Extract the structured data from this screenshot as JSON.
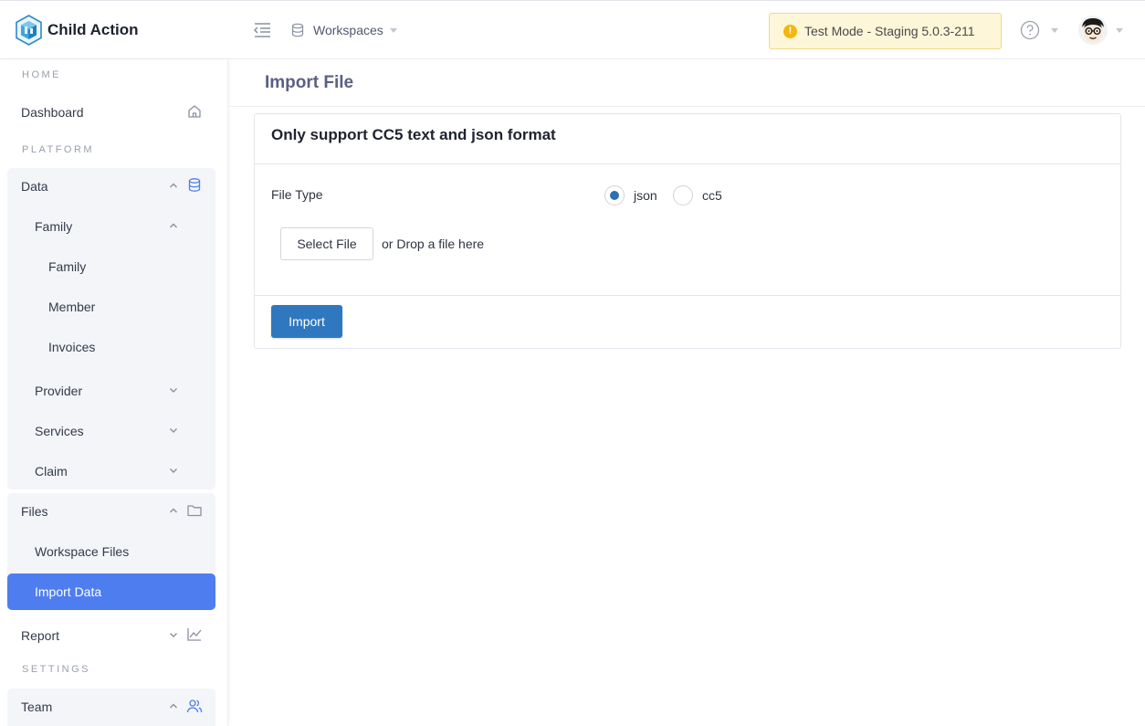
{
  "brand": {
    "name": "Child Action"
  },
  "topbar": {
    "workspaces_label": "Workspaces",
    "test_mode": "Test Mode - Staging 5.0.3-211",
    "icons": {
      "menu": "menu-fold-icon",
      "workspace": "database-icon",
      "warning": "warning-icon",
      "help": "help-circle-icon",
      "avatar": "avatar-icon"
    }
  },
  "sidebar": {
    "sections": {
      "home": "HOME",
      "platform": "PLATFORM",
      "settings": "SETTINGS"
    },
    "dashboard": "Dashboard",
    "data": {
      "label": "Data",
      "family": {
        "label": "Family",
        "items": [
          "Family",
          "Member",
          "Invoices"
        ]
      },
      "provider": "Provider",
      "services": "Services",
      "claim": "Claim"
    },
    "files": {
      "label": "Files",
      "workspace_files": "Workspace Files",
      "import_data": "Import Data"
    },
    "report": "Report",
    "team": "Team",
    "active_color": "#4e7df0"
  },
  "page": {
    "title": "Import File"
  },
  "card": {
    "title": "Only support CC5 text and json format",
    "file_type_label": "File Type",
    "options": [
      {
        "label": "json",
        "selected": true
      },
      {
        "label": "cc5",
        "selected": false
      }
    ],
    "select_file": "Select File",
    "drop_text": "or Drop a file here",
    "import": "Import"
  },
  "colors": {
    "primary_button": "#2f78c0",
    "title": "#5a5f84",
    "test_mode_bg": "#fdf6d9"
  }
}
